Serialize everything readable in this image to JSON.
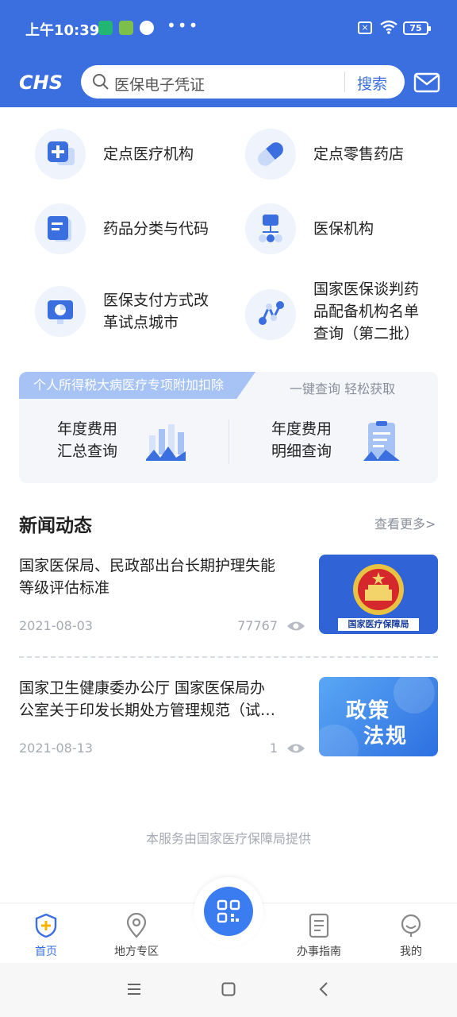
{
  "status_bar": {
    "time": "上午10:39",
    "dots": "•••",
    "sim_icon": "sim-x-icon",
    "wifi_icon": "wifi-icon",
    "battery": "75"
  },
  "header": {
    "logo_text": "CHS",
    "search_placeholder": "医保电子凭证",
    "search_button": "搜索",
    "mail_icon": "mail-icon"
  },
  "services": [
    {
      "label": "定点医疗机构",
      "icon": "medical-cross-icon"
    },
    {
      "label": "定点零售药店",
      "icon": "pill-icon"
    },
    {
      "label": "药品分类与代码",
      "icon": "document-icon"
    },
    {
      "label": "医保机构",
      "icon": "org-chart-icon"
    },
    {
      "label_line1": "医保支付方式改",
      "label_line2": "革试点城市",
      "icon": "monitor-chart-icon"
    },
    {
      "label_line1": "国家医保谈判药",
      "label_line2": "品配备机构名单",
      "label_line3": "查询（第二批）",
      "icon": "network-icon"
    }
  ],
  "tax_card": {
    "tag": "个人所得税大病医疗专项附加扣除",
    "hint": "一键查询 轻松获取",
    "items": [
      {
        "line1": "年度费用",
        "line2": "汇总查询"
      },
      {
        "line1": "年度费用",
        "line2": "明细查询"
      }
    ]
  },
  "news": {
    "heading": "新闻动态",
    "more": "查看更多>",
    "items": [
      {
        "title_line1": "国家医保局、民政部出台长期护理失能",
        "title_line2": "等级评估标准",
        "date": "2021-08-03",
        "views": "77767",
        "thumb_caption": "国家医疗保障局"
      },
      {
        "title_line1": "国家卫生健康委办公厅 国家医保局办",
        "title_line2": "公室关于印发长期处方管理规范（试…",
        "date": "2021-08-13",
        "views": "1",
        "thumb_line1": "政策",
        "thumb_line2": "法规"
      }
    ]
  },
  "footer_note": "本服务由国家医疗保障局提供",
  "bottom_nav": [
    {
      "label": "首页",
      "icon": "home-shield-icon",
      "active": true
    },
    {
      "label": "地方专区",
      "icon": "location-pin-icon"
    },
    {
      "label": "办事指南",
      "icon": "guide-doc-icon"
    },
    {
      "label": "我的",
      "icon": "smile-face-icon"
    }
  ],
  "colors": {
    "primary": "#3b6fe0",
    "accent_light": "#a7c2f5",
    "icon_bg": "#eef3fc"
  }
}
